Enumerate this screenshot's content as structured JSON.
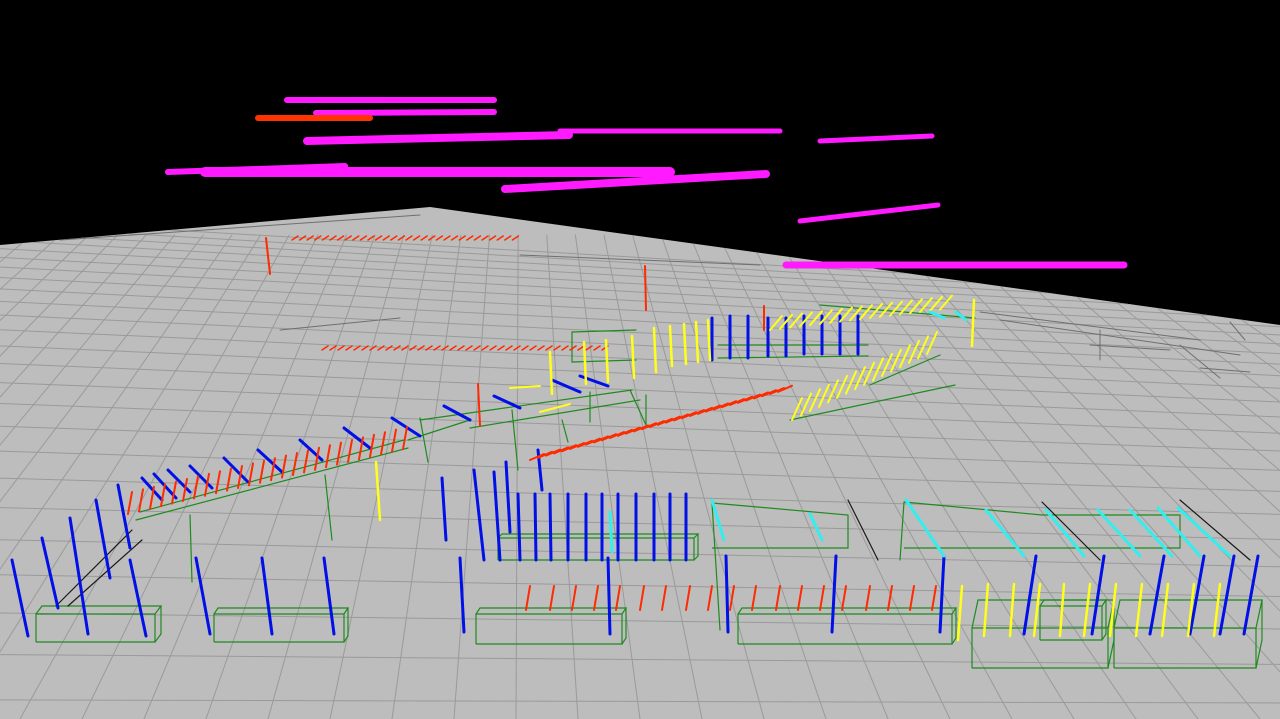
{
  "scene": {
    "background_color": "#000000",
    "floor_color": "#bdbdbd",
    "grid_color": "#9a9a9a",
    "plan_line_color": "#6f6f6f",
    "colors": {
      "magenta": "#ff1aff",
      "orange_red": "#ff3300",
      "red": "#ff2a00",
      "blue": "#0010e6",
      "yellow": "#ffff1a",
      "cyan": "#33eeee",
      "green": "#1f8a1f",
      "dark": "#1a1a1a"
    },
    "legend": []
  }
}
